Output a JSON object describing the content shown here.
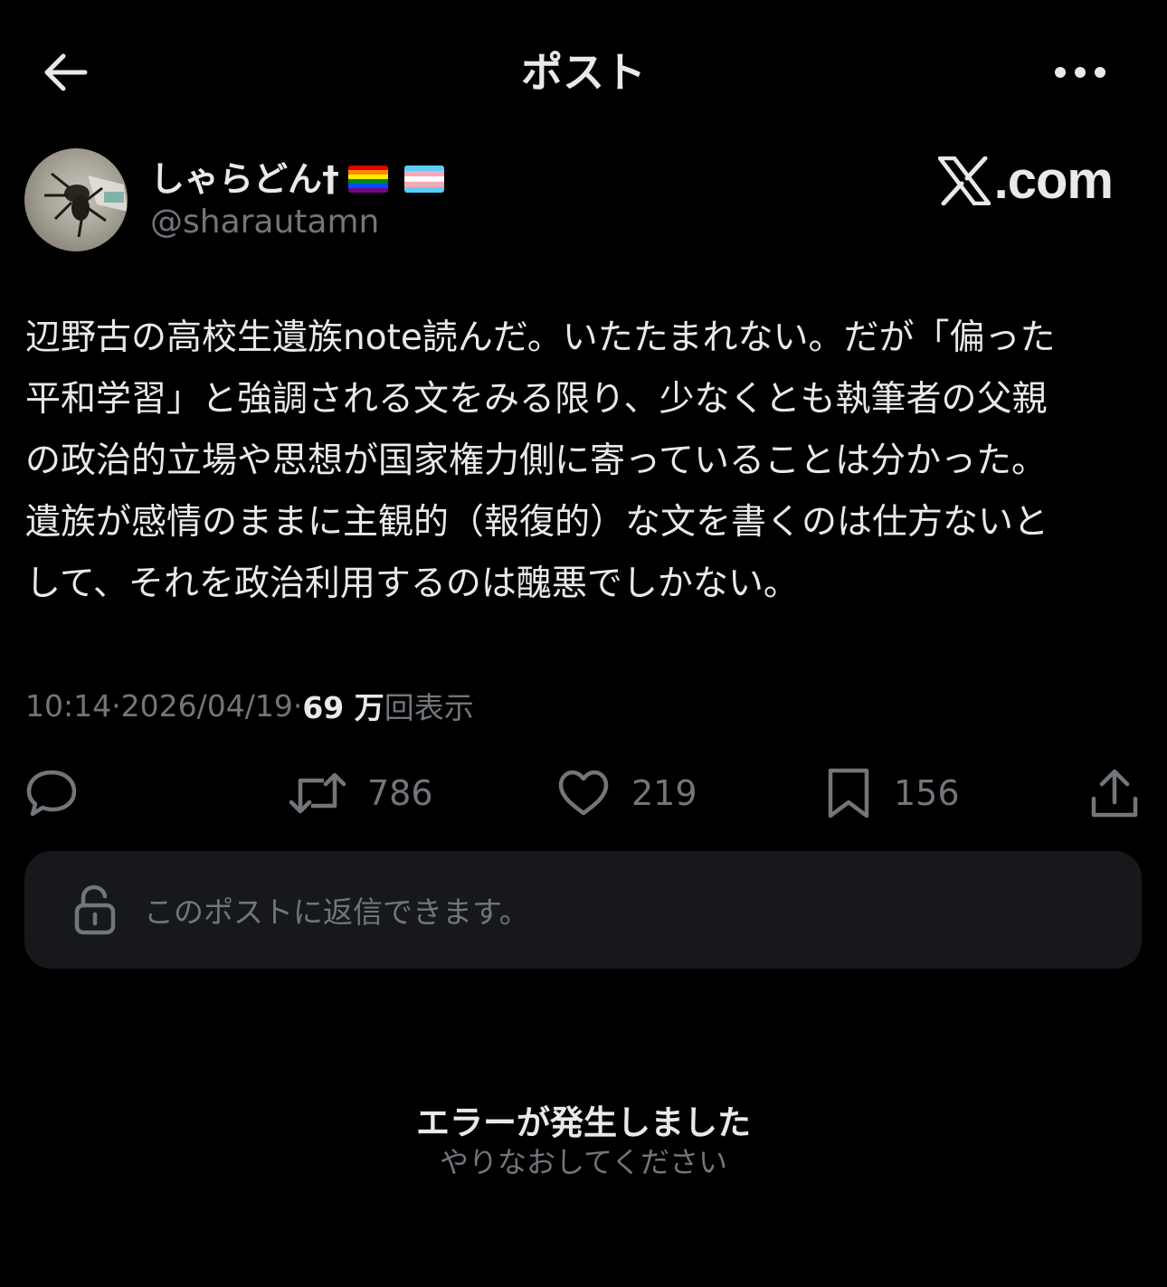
{
  "header": {
    "title": "ポスト"
  },
  "author": {
    "display_name": "しゃらどん†",
    "handle": "@sharautamn"
  },
  "watermark": {
    "text": "com"
  },
  "post": {
    "body": "辺野古の高校生遺族note読んだ。いたたまれない。だが「偏った\n平和学習」と強調される文をみる限り、少なくとも執筆者の父親\nの政治的立場や思想が国家権力側に寄っていることは分かった。\n遺族が感情のままに主観的（報復的）な文を書くのは仕方ないと\nして、それを政治利用するのは醜悪でしかない。",
    "time": "10:14",
    "date": "2026/04/19",
    "separator": " · ",
    "views_number": "69 万",
    "views_label": "回表示"
  },
  "actions": {
    "reply_count": "",
    "retweet_count": "786",
    "like_count": "219",
    "bookmark_count": "156"
  },
  "reply_box": {
    "note": "このポストに返信できます。"
  },
  "error": {
    "title": "エラーが発生しました",
    "subtitle": "やりなおしてください"
  },
  "icons": {
    "back": "arrow-left-icon",
    "more": "more-horizontal-icon",
    "reply": "speech-bubble-icon",
    "retweet": "retweet-icon",
    "like": "heart-icon",
    "bookmark": "bookmark-icon",
    "share": "share-icon",
    "lock": "unlock-icon"
  },
  "colors": {
    "background": "#000000",
    "primary_text": "#e7e9ea",
    "secondary_text": "#71767b",
    "reply_box_bg": "#16181c"
  }
}
